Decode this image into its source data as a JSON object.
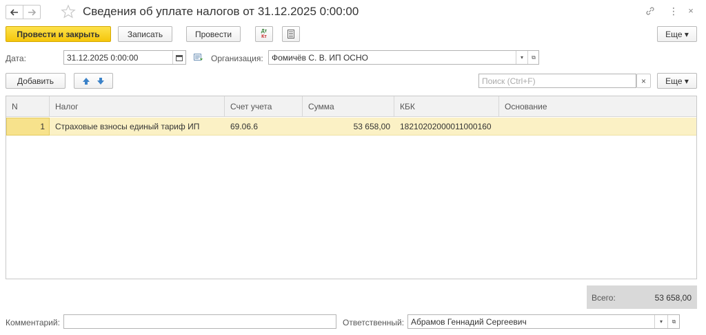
{
  "header": {
    "title": "Сведения об уплате налогов от 31.12.2025 0:00:00",
    "back_icon": "arrow-left-icon",
    "forward_icon": "arrow-right-icon",
    "favorite_icon": "star-icon",
    "link_icon": "link-icon",
    "more_icon": "vertical-ellipsis-icon",
    "close_icon": "close-icon"
  },
  "toolbar": {
    "post_close_label": "Провести и закрыть",
    "save_label": "Записать",
    "post_label": "Провести",
    "dt_kt_label_top": "Дт",
    "dt_kt_label_bottom": "Кт",
    "more_label": "Еще ▾"
  },
  "fields": {
    "date_label": "Дата:",
    "date_value": "31.12.2025  0:00:00",
    "org_label": "Организация:",
    "org_value": "Фомичёв С. В. ИП ОСНО"
  },
  "table_toolbar": {
    "add_label": "Добавить",
    "search_placeholder": "Поиск (Ctrl+F)",
    "search_clear": "×",
    "more_label": "Еще ▾"
  },
  "table": {
    "columns": [
      "N",
      "Налог",
      "Счет учета",
      "Сумма",
      "КБК",
      "Основание"
    ],
    "rows": [
      {
        "n": "1",
        "tax": "Страховые взносы единый тариф ИП",
        "account": "69.06.6",
        "amount": "53 658,00",
        "kbk": "18210202000011000160",
        "basis": ""
      }
    ]
  },
  "total": {
    "label": "Всего:",
    "value": "53 658,00"
  },
  "footer": {
    "comment_label": "Комментарий:",
    "comment_value": "",
    "responsible_label": "Ответственный:",
    "responsible_value": "Абрамов Геннадий Сергеевич"
  },
  "colors": {
    "accent_yellow": "#f5c60b",
    "row_highlight": "#fbf1c5",
    "total_bg": "#d9d9d9"
  }
}
